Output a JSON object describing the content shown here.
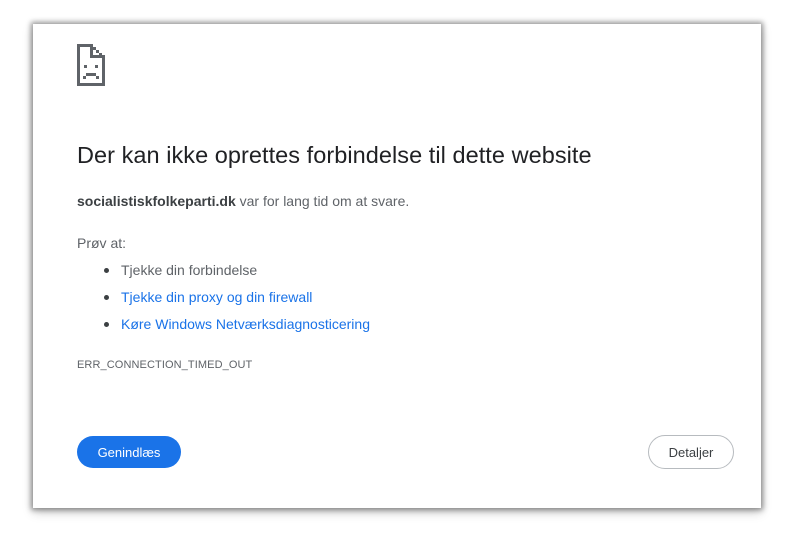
{
  "error_page": {
    "icon": "sad-page-icon",
    "heading": "Der kan ikke oprettes forbindelse til dette website",
    "host": "socialistiskfolkeparti.dk",
    "summary_suffix": " var for lang tid om at svare.",
    "try_label": "Prøv at:",
    "suggestions": [
      {
        "text": "Tjekke din forbindelse",
        "is_link": false
      },
      {
        "text": "Tjekke din proxy og din firewall",
        "is_link": true
      },
      {
        "text": "Køre Windows Netværksdiagnosticering",
        "is_link": true
      }
    ],
    "error_code": "ERR_CONNECTION_TIMED_OUT",
    "reload_label": "Genindlæs",
    "details_label": "Detaljer"
  },
  "colors": {
    "accent": "#1a73e8",
    "heading": "#202124",
    "body_text": "#5f6368"
  }
}
